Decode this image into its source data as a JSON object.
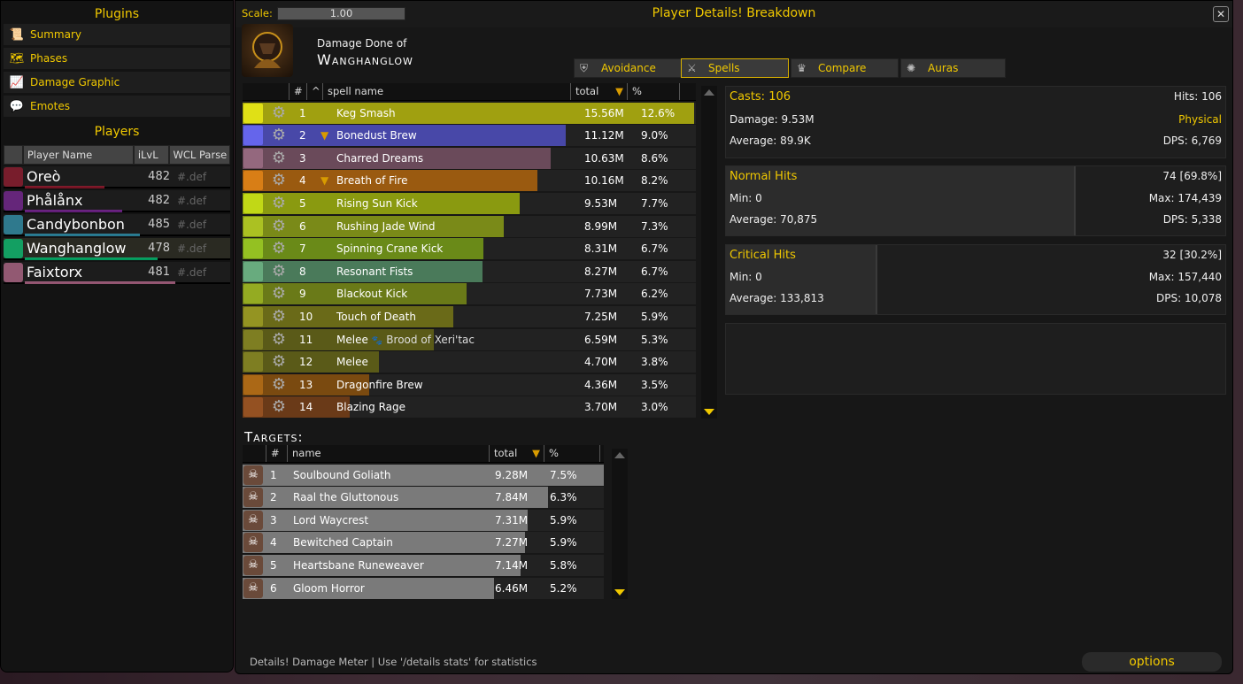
{
  "sidebar": {
    "plugins_title": "Plugins",
    "plugins": [
      {
        "label": "Summary",
        "icon": "scroll-icon"
      },
      {
        "label": "Phases",
        "icon": "map-icon"
      },
      {
        "label": "Damage Graphic",
        "icon": "line-graph-icon"
      },
      {
        "label": "Emotes",
        "icon": "speech-bubble-icon"
      }
    ],
    "players_title": "Players",
    "columns": [
      "Player Name",
      "iLvL",
      "WCL Parse"
    ],
    "players": [
      {
        "name": "Oreò",
        "ilvl": "482",
        "parse": "#.def",
        "color": "#c41f3b"
      },
      {
        "name": "Phålånx",
        "ilvl": "482",
        "parse": "#.def",
        "color": "#a330c9"
      },
      {
        "name": "Candybonbon",
        "ilvl": "485",
        "parse": "#.def",
        "color": "#3fc7eb"
      },
      {
        "name": "Wanghanglow",
        "ilvl": "478",
        "parse": "#.def",
        "color": "#00ff98"
      },
      {
        "name": "Faixtorx",
        "ilvl": "481",
        "parse": "#.def",
        "color": "#f48cba"
      }
    ]
  },
  "window": {
    "scale_label": "Scale:",
    "scale_value": "1.00",
    "title": "Player Details! Breakdown",
    "close": "✕",
    "damage_done_label": "Damage Done of",
    "player_name": "Wanghanglow"
  },
  "tabs": [
    {
      "label": "Avoidance",
      "icon": "shield-icon",
      "active": false
    },
    {
      "label": "Spells",
      "icon": "crossed-swords-icon",
      "active": true
    },
    {
      "label": "Compare",
      "icon": "crown-icon",
      "active": false
    },
    {
      "label": "Auras",
      "icon": "aura-icon",
      "active": false
    }
  ],
  "spells": {
    "columns": [
      "#",
      "^",
      "spell name",
      "total",
      "%"
    ],
    "sort_arrow": "▼",
    "rows": [
      {
        "rank": "1",
        "name": "Keg Smash",
        "total": "15.56M",
        "pct": "12.6%",
        "share": 1.0,
        "color": "#a0a010",
        "expand": false
      },
      {
        "rank": "2",
        "name": "Bonedust Brew",
        "total": "11.12M",
        "pct": "9.0%",
        "share": 0.715,
        "color": "#4848a8",
        "expand": true
      },
      {
        "rank": "3",
        "name": "Charred Dreams",
        "total": "10.63M",
        "pct": "8.6%",
        "share": 0.683,
        "color": "#6a4a5a",
        "expand": false
      },
      {
        "rank": "4",
        "name": "Breath of Fire",
        "total": "10.16M",
        "pct": "8.2%",
        "share": 0.653,
        "color": "#9a5a10",
        "expand": true
      },
      {
        "rank": "5",
        "name": "Rising Sun Kick",
        "total": "9.53M",
        "pct": "7.7%",
        "share": 0.613,
        "color": "#8a9a10",
        "expand": false
      },
      {
        "rank": "6",
        "name": "Rushing Jade Wind",
        "total": "8.99M",
        "pct": "7.3%",
        "share": 0.578,
        "color": "#7a8a18",
        "expand": false
      },
      {
        "rank": "7",
        "name": "Spinning Crane Kick",
        "total": "8.31M",
        "pct": "6.7%",
        "share": 0.534,
        "color": "#6a8a18",
        "expand": false
      },
      {
        "rank": "8",
        "name": "Resonant Fists",
        "total": "8.27M",
        "pct": "6.7%",
        "share": 0.532,
        "color": "#4a7a5a",
        "expand": false
      },
      {
        "rank": "9",
        "name": "Blackout Kick",
        "total": "7.73M",
        "pct": "6.2%",
        "share": 0.497,
        "color": "#6a7a18",
        "expand": false
      },
      {
        "rank": "10",
        "name": "Touch of Death",
        "total": "7.25M",
        "pct": "5.9%",
        "share": 0.466,
        "color": "#6a6a18",
        "expand": false
      },
      {
        "rank": "11",
        "name": "Melee",
        "pet": "Brood of Xeri'tac",
        "total": "6.59M",
        "pct": "5.3%",
        "share": 0.424,
        "color": "#5a5a18",
        "expand": false
      },
      {
        "rank": "12",
        "name": "Melee",
        "total": "4.70M",
        "pct": "3.8%",
        "share": 0.302,
        "color": "#5a5a18",
        "expand": false
      },
      {
        "rank": "13",
        "name": "Dragonfire Brew",
        "total": "4.36M",
        "pct": "3.5%",
        "share": 0.28,
        "color": "#7a4a10",
        "expand": false
      },
      {
        "rank": "14",
        "name": "Blazing Rage",
        "total": "3.70M",
        "pct": "3.0%",
        "share": 0.238,
        "color": "#6a3a18",
        "expand": false
      }
    ]
  },
  "stats": {
    "summary": {
      "casts": "Casts: 106",
      "hits": "Hits: 106",
      "damage": "Damage: 9.53M",
      "school": "Physical",
      "average": "Average: 89.9K",
      "dps": "DPS: 6,769"
    },
    "normal": {
      "title": "Normal Hits",
      "count": "74",
      "pct": "[69.8%]",
      "min": "Min: 0",
      "max": "Max: 174,439",
      "average": "Average: 70,875",
      "dps": "DPS: 5,338",
      "share": 0.698
    },
    "critical": {
      "title": "Critical Hits",
      "count": "32",
      "pct": "[30.2%]",
      "min": "Min: 0",
      "max": "Max: 157,440",
      "average": "Average: 133,813",
      "dps": "DPS: 10,078",
      "share": 0.302
    }
  },
  "targets": {
    "title": "Targets:",
    "columns": [
      "#",
      "name",
      "total",
      "%"
    ],
    "rows": [
      {
        "rank": "1",
        "name": "Soulbound Goliath",
        "total": "9.28M",
        "pct": "7.5%",
        "share": 1.0
      },
      {
        "rank": "2",
        "name": "Raal the Gluttonous",
        "total": "7.84M",
        "pct": "6.3%",
        "share": 0.845
      },
      {
        "rank": "3",
        "name": "Lord Waycrest",
        "total": "7.31M",
        "pct": "5.9%",
        "share": 0.788
      },
      {
        "rank": "4",
        "name": "Bewitched Captain",
        "total": "7.27M",
        "pct": "5.9%",
        "share": 0.783
      },
      {
        "rank": "5",
        "name": "Heartsbane Runeweaver",
        "total": "7.14M",
        "pct": "5.8%",
        "share": 0.769
      },
      {
        "rank": "6",
        "name": "Gloom Horror",
        "total": "6.46M",
        "pct": "5.2%",
        "share": 0.696
      }
    ]
  },
  "footer": {
    "hint": "Details! Damage Meter | Use '/details stats' for statistics",
    "options": "options"
  }
}
